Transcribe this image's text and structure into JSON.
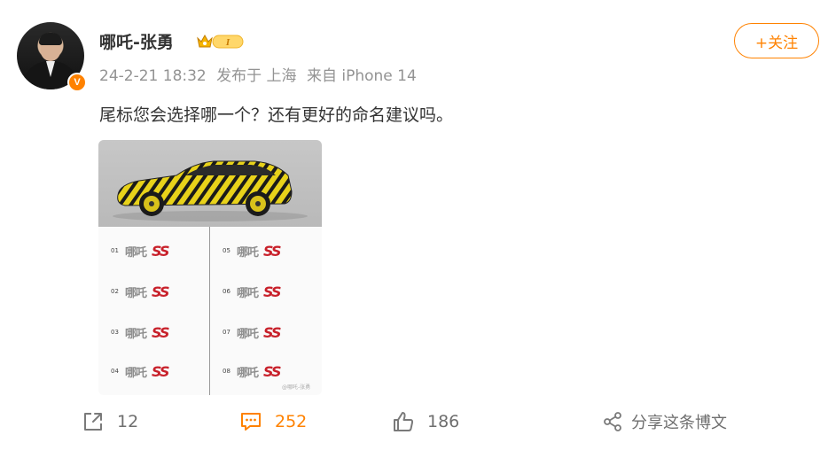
{
  "post": {
    "username": "哪吒-张勇",
    "level_badge": "I",
    "timestamp": "24-2-21 18:32",
    "location": "发布于 上海",
    "source": "来自 iPhone 14",
    "text": "尾标您会选择哪一个？还有更好的命名建议吗。",
    "follow_label": "+关注",
    "verified_mark": "V"
  },
  "image": {
    "options": [
      {
        "num": "01",
        "brand": "哪吒",
        "mark": "SS"
      },
      {
        "num": "02",
        "brand": "哪吒",
        "mark": "SS"
      },
      {
        "num": "03",
        "brand": "哪吒",
        "mark": "SS"
      },
      {
        "num": "04",
        "brand": "哪吒",
        "mark": "SS"
      },
      {
        "num": "05",
        "brand": "哪吒",
        "mark": "SS"
      },
      {
        "num": "06",
        "brand": "哪吒",
        "mark": "SS"
      },
      {
        "num": "07",
        "brand": "哪吒",
        "mark": "SS"
      },
      {
        "num": "08",
        "brand": "哪吒",
        "mark": "SS"
      }
    ],
    "watermark": "@哪吒-张勇"
  },
  "actions": {
    "repost_count": "12",
    "comment_count": "252",
    "like_count": "186",
    "share_label": "分享这条博文"
  },
  "colors": {
    "accent": "#ff8200",
    "text_muted": "#939393"
  }
}
